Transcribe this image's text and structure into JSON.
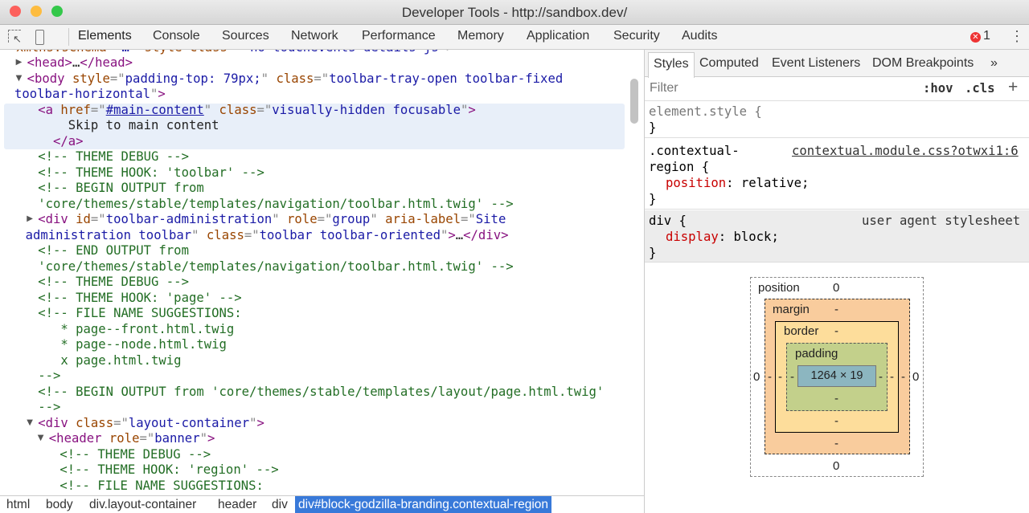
{
  "window": {
    "title": "Developer Tools - http://sandbox.dev/"
  },
  "toolbar": {
    "tabs": [
      "Elements",
      "Console",
      "Sources",
      "Network",
      "Performance",
      "Memory",
      "Application",
      "Security",
      "Audits"
    ],
    "active_tab": "Elements",
    "error_count": "1",
    "icons": [
      "inspect-element-icon",
      "device-toolbar-icon",
      "error-icon",
      "more-menu-icon"
    ]
  },
  "elements": {
    "lines": [
      {
        "depth": 0,
        "y": -1,
        "seg": [
          [
            "an",
            "xmlns:schema"
          ],
          [
            "p",
            "=\""
          ],
          [
            "av",
            "…"
          ],
          [
            "p",
            "\" "
          ],
          [
            "an",
            "style class"
          ],
          [
            "p",
            "=\""
          ],
          [
            "av",
            " no-touchevents details js"
          ],
          [
            "p",
            "\">"
          ]
        ]
      },
      {
        "depth": 1,
        "tri": "closed",
        "seg": [
          [
            "t",
            "<head>"
          ],
          [
            "tx",
            "…"
          ],
          [
            "t",
            "</head>"
          ]
        ]
      },
      {
        "depth": 1,
        "tri": "open",
        "seg": [
          [
            "t",
            "<body "
          ],
          [
            "an",
            "style"
          ],
          [
            "p",
            "=\""
          ],
          [
            "av",
            "padding-top: 79px;"
          ],
          [
            "p",
            "\" "
          ],
          [
            "an",
            "class"
          ],
          [
            "p",
            "=\""
          ],
          [
            "av",
            "toolbar-tray-open toolbar-fixed"
          ]
        ]
      },
      {
        "depth": 0,
        "wrap": true,
        "seg": [
          [
            "av",
            "toolbar-horizontal"
          ],
          [
            "p",
            "\""
          ],
          [
            "t",
            ">"
          ]
        ]
      },
      {
        "depth": 2,
        "seg": [
          [
            "t",
            "<a "
          ],
          [
            "an",
            "href"
          ],
          [
            "p",
            "=\""
          ],
          [
            "lk",
            "#main-content"
          ],
          [
            "p",
            "\" "
          ],
          [
            "an",
            "class"
          ],
          [
            "p",
            "=\""
          ],
          [
            "av",
            "visually-hidden focusable"
          ],
          [
            "p",
            "\""
          ],
          [
            "t",
            ">"
          ]
        ]
      },
      {
        "depth": 2,
        "seg": [
          [
            "tx",
            "    Skip to main content"
          ]
        ]
      },
      {
        "depth": 2,
        "seg": [
          [
            "t",
            "  </a>"
          ]
        ]
      },
      {
        "depth": 2,
        "seg": [
          [
            "c",
            "<!-- THEME DEBUG -->"
          ]
        ]
      },
      {
        "depth": 2,
        "seg": [
          [
            "c",
            "<!-- THEME HOOK: 'toolbar' -->"
          ]
        ]
      },
      {
        "depth": 2,
        "seg": [
          [
            "c",
            "<!-- BEGIN OUTPUT from"
          ]
        ]
      },
      {
        "depth": 2,
        "seg": [
          [
            "c",
            "'core/themes/stable/templates/navigation/toolbar.html.twig' -->"
          ]
        ]
      },
      {
        "depth": 2,
        "tri": "closed",
        "seg": [
          [
            "t",
            "<div "
          ],
          [
            "an",
            "id"
          ],
          [
            "p",
            "=\""
          ],
          [
            "av",
            "toolbar-administration"
          ],
          [
            "p",
            "\" "
          ],
          [
            "an",
            "role"
          ],
          [
            "p",
            "=\""
          ],
          [
            "av",
            "group"
          ],
          [
            "p",
            "\" "
          ],
          [
            "an",
            "aria-label"
          ],
          [
            "p",
            "=\""
          ],
          [
            "av",
            "Site"
          ]
        ]
      },
      {
        "depth": 1,
        "wrap": true,
        "seg": [
          [
            "av",
            "administration toolbar"
          ],
          [
            "p",
            "\" "
          ],
          [
            "an",
            "class"
          ],
          [
            "p",
            "=\""
          ],
          [
            "av",
            "toolbar toolbar-oriented"
          ],
          [
            "p",
            "\""
          ],
          [
            "t",
            ">"
          ],
          [
            "tx",
            "…"
          ],
          [
            "t",
            "</div>"
          ]
        ]
      },
      {
        "depth": 2,
        "seg": [
          [
            "c",
            "<!-- END OUTPUT from"
          ]
        ]
      },
      {
        "depth": 2,
        "seg": [
          [
            "c",
            "'core/themes/stable/templates/navigation/toolbar.html.twig' -->"
          ]
        ]
      },
      {
        "depth": 2,
        "seg": [
          [
            "c",
            "<!-- THEME DEBUG -->"
          ]
        ]
      },
      {
        "depth": 2,
        "seg": [
          [
            "c",
            "<!-- THEME HOOK: 'page' -->"
          ]
        ]
      },
      {
        "depth": 2,
        "seg": [
          [
            "c",
            "<!-- FILE NAME SUGGESTIONS:"
          ]
        ]
      },
      {
        "depth": 2,
        "seg": [
          [
            "c",
            "   * page--front.html.twig"
          ]
        ]
      },
      {
        "depth": 2,
        "seg": [
          [
            "c",
            "   * page--node.html.twig"
          ]
        ]
      },
      {
        "depth": 2,
        "seg": [
          [
            "c",
            "   x page.html.twig"
          ]
        ]
      },
      {
        "depth": 2,
        "seg": [
          [
            "c",
            "-->"
          ]
        ]
      },
      {
        "depth": 2,
        "seg": [
          [
            "c",
            "<!-- BEGIN OUTPUT from 'core/themes/stable/templates/layout/page.html.twig'"
          ]
        ]
      },
      {
        "depth": 2,
        "seg": [
          [
            "c",
            "-->"
          ]
        ]
      },
      {
        "depth": 2,
        "tri": "open",
        "seg": [
          [
            "t",
            "<div "
          ],
          [
            "an",
            "class"
          ],
          [
            "p",
            "=\""
          ],
          [
            "av",
            "layout-container"
          ],
          [
            "p",
            "\""
          ],
          [
            "t",
            ">"
          ]
        ]
      },
      {
        "depth": 3,
        "tri": "open",
        "seg": [
          [
            "t",
            "<header "
          ],
          [
            "an",
            "role"
          ],
          [
            "p",
            "=\""
          ],
          [
            "av",
            "banner"
          ],
          [
            "p",
            "\""
          ],
          [
            "t",
            ">"
          ]
        ]
      },
      {
        "depth": 4,
        "seg": [
          [
            "c",
            "<!-- THEME DEBUG -->"
          ]
        ]
      },
      {
        "depth": 4,
        "seg": [
          [
            "c",
            "<!-- THEME HOOK: 'region' -->"
          ]
        ]
      },
      {
        "depth": 4,
        "seg": [
          [
            "c",
            "<!-- FILE NAME SUGGESTIONS:"
          ]
        ]
      }
    ],
    "breadcrumbs": [
      "html",
      "body",
      "div.layout-container",
      "header",
      "div",
      "div#block-godzilla-branding.contextual-region"
    ]
  },
  "styles": {
    "tabs": [
      "Styles",
      "Computed",
      "Event Listeners",
      "DOM Breakpoints",
      "»"
    ],
    "filter_placeholder": "Filter",
    "hov": ":hov",
    "cls": ".cls",
    "add": "+",
    "element_style": "element.style {",
    "close": "}",
    "rule1": {
      "selector1": ".contextual-",
      "selector2": "region {",
      "source": "contextual.module.css?otwxi1:6",
      "prop": "position",
      "value": " relative;"
    },
    "rule2": {
      "selector": "div {",
      "source": "user agent stylesheet",
      "prop": "display",
      "value": " block;"
    },
    "colon": ":"
  },
  "box_model": {
    "position_label": "position",
    "position_top": "0",
    "position_bottom": "0",
    "position_left": "0",
    "position_right": "0",
    "margin_label": "margin",
    "margin": "-",
    "border_label": "border",
    "border": "-",
    "padding_label": "padding",
    "padding": "-",
    "content": "1264 × 19",
    "colors": {
      "margin": "#f9cc9d",
      "border": "#fddd9b",
      "padding": "#c3d08b",
      "content": "#8cb6c0"
    }
  }
}
